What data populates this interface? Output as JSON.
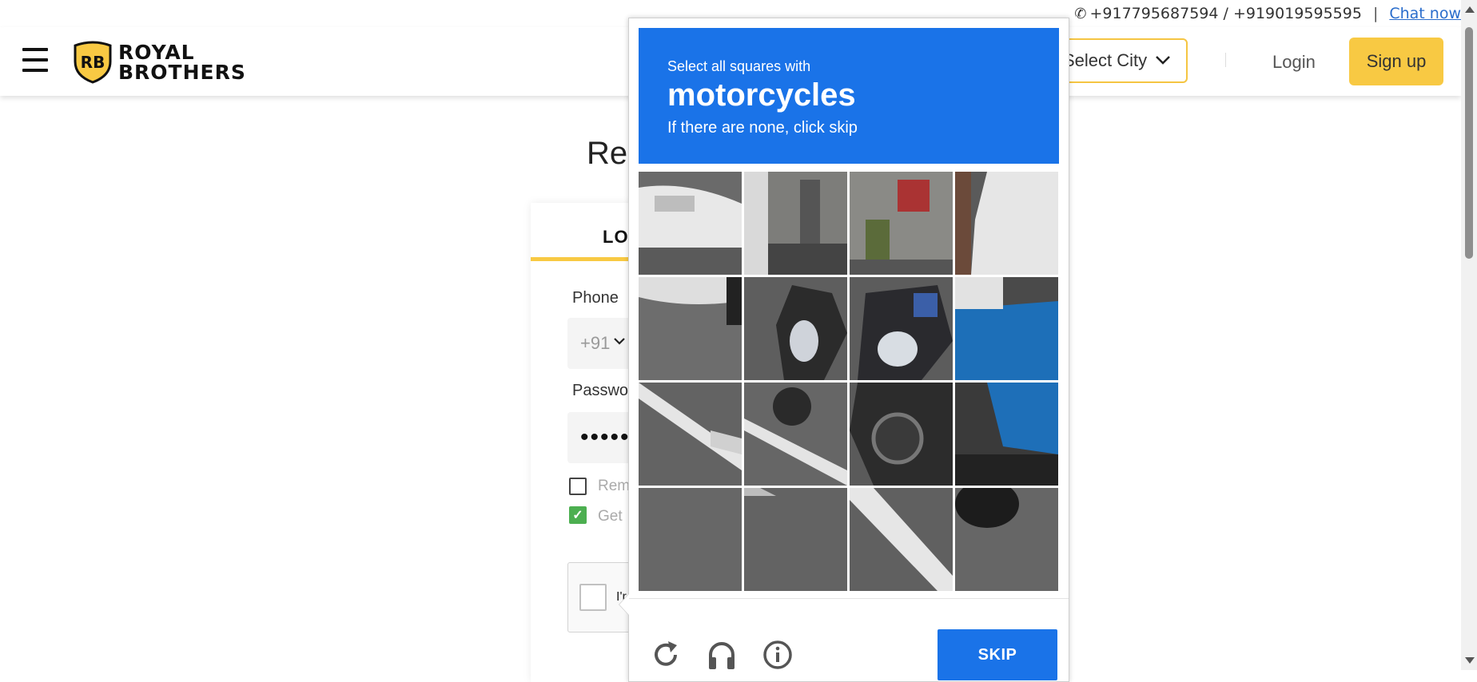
{
  "contact": {
    "phones": "+917795687594 / +919019595595",
    "separator": "|",
    "chat_label": "Chat now"
  },
  "header": {
    "logo_line1": "ROYAL",
    "logo_line2": "BROTHERS",
    "logo_badge": "RB",
    "city_select": "Select City",
    "login_label": "Login",
    "signup_label": "Sign up"
  },
  "page": {
    "title_visible": "Ren",
    "tab_login": "LOG",
    "phone_label": "Phone",
    "phone_code": "+91",
    "password_label": "Passwo",
    "password_mask": "•••••",
    "remember_label": "Rem",
    "get_label": "Get",
    "get_checked": true,
    "recaptcha_label": "I'r"
  },
  "captcha": {
    "instruction": "Select all squares with",
    "target": "motorcycles",
    "hint": "If there are none, click skip",
    "skip_label": "SKIP",
    "icons": [
      "reload-icon",
      "headphones-icon",
      "info-icon"
    ],
    "accent_color": "#1a73e8"
  }
}
